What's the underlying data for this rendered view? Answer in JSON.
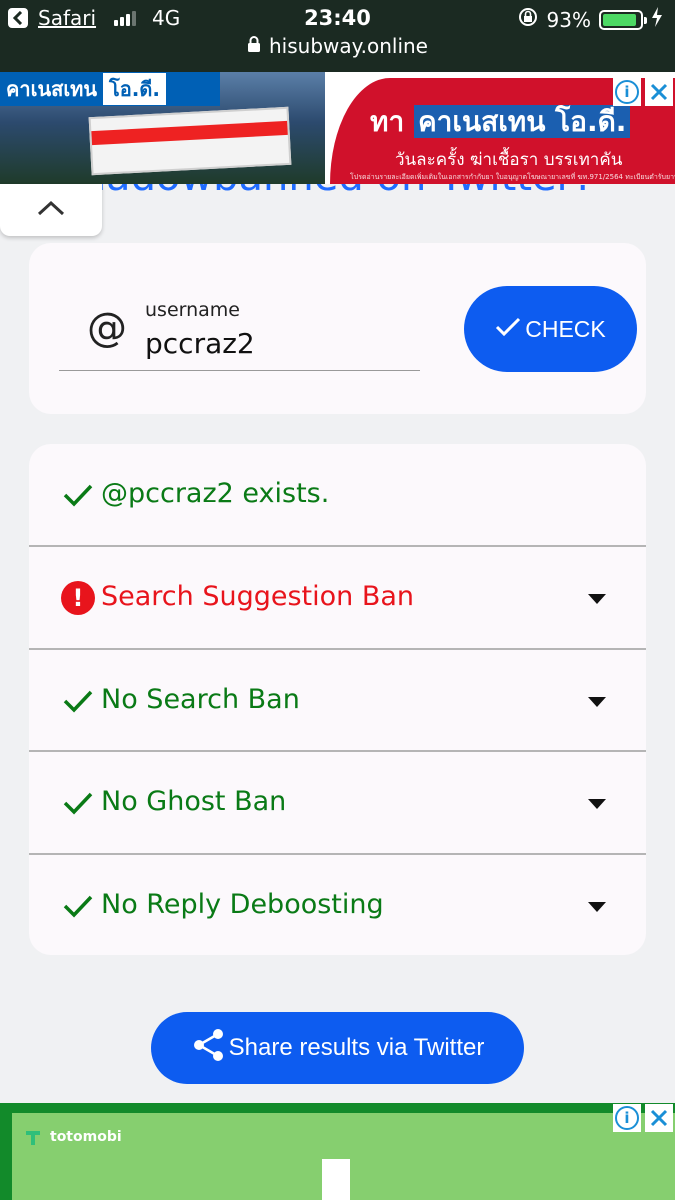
{
  "status_bar": {
    "back_app": "Safari",
    "network": "4G",
    "time": "23:40",
    "battery_percent": "93%",
    "battery_level": 0.93,
    "url": "hisubway.online"
  },
  "ad_top": {
    "brand": "คาเนสเทน",
    "brand_suffix": "โอ.ดี.",
    "headline_prefix": "ทา",
    "headline_highlight": "คาเนสเทน โอ.ดี.",
    "subline": "วันละครั้ง ฆ่าเชื้อรา บรรเทาคัน",
    "fine_print": "โปรดอ่านรายละเอียดเพิ่มเติมในเอกสารกำกับยา ใบอนุญาตโฆษณายาเลขที่ ฆท.971/2564 ทะเบียนตำรับยาที่ 1C 79/54"
  },
  "page": {
    "title_partial": "hadowbanned on Twitter?"
  },
  "form": {
    "at_symbol": "@",
    "label": "username",
    "value": "pccraz2",
    "check_label": "CHECK"
  },
  "results": [
    {
      "text": "@pccraz2 exists.",
      "status": "ok",
      "expandable": false
    },
    {
      "text": "Search Suggestion Ban",
      "status": "ban",
      "expandable": true
    },
    {
      "text": "No Search Ban",
      "status": "ok",
      "expandable": true
    },
    {
      "text": "No Ghost Ban",
      "status": "ok",
      "expandable": true
    },
    {
      "text": "No Reply Deboosting",
      "status": "ok",
      "expandable": true
    }
  ],
  "share": {
    "label": "Share results via Twitter"
  },
  "ad_bottom": {
    "brand": "totomobi"
  },
  "colors": {
    "primary": "#0d5cf0",
    "ok": "#0a7a16",
    "ban": "#e8141c"
  }
}
